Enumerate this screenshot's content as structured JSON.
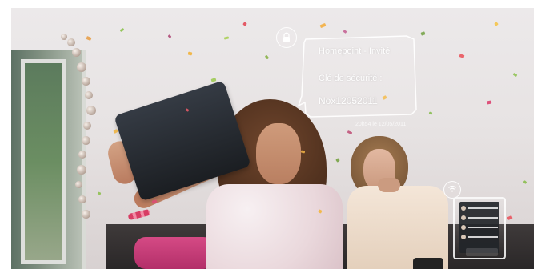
{
  "overlay": {
    "wifi_name": "Homepoint - Invité",
    "security_label": "Clé de sécurité :",
    "security_key": "Nox12052011",
    "date_stamp": "20h54 le 12/05/2011"
  },
  "icons": {
    "lock": "lock-icon",
    "wifi": "wifi-icon",
    "tablet": "tablet-icon"
  },
  "colors": {
    "overlay_line": "#ffffff",
    "pillow": "#d54a85",
    "sofa": "#2f2a2b",
    "tablet_dark": "#1f2328"
  }
}
